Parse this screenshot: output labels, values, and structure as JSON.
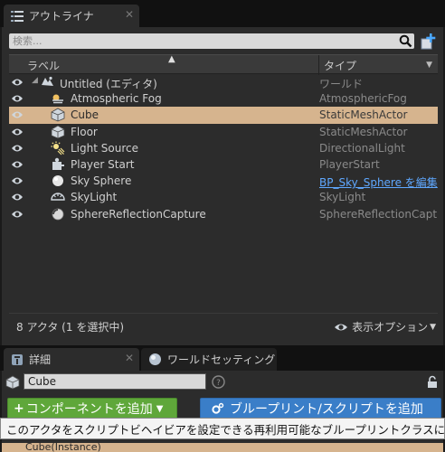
{
  "outliner": {
    "tab_label": "アウトライナ",
    "tab_close": "✕",
    "search_placeholder": "検索...",
    "columns": {
      "label": "ラベル",
      "type": "タイプ"
    },
    "rows": [
      {
        "name": "Untitled (エディタ)",
        "type": "ワールド",
        "icon": "world-icon",
        "indent": 0,
        "selected": false,
        "link": false
      },
      {
        "name": "Atmospheric Fog",
        "type": "AtmosphericFog",
        "icon": "fog-icon",
        "indent": 1,
        "selected": false,
        "link": false
      },
      {
        "name": "Cube",
        "type": "StaticMeshActor",
        "icon": "static-mesh-icon",
        "indent": 1,
        "selected": true,
        "link": false
      },
      {
        "name": "Floor",
        "type": "StaticMeshActor",
        "icon": "static-mesh-icon",
        "indent": 1,
        "selected": false,
        "link": false
      },
      {
        "name": "Light Source",
        "type": "DirectionalLight",
        "icon": "directional-light-icon",
        "indent": 1,
        "selected": false,
        "link": false
      },
      {
        "name": "Player Start",
        "type": "PlayerStart",
        "icon": "player-start-icon",
        "indent": 1,
        "selected": false,
        "link": false
      },
      {
        "name": "Sky Sphere",
        "type": "BP_Sky_Sphere を編集",
        "icon": "sphere-icon",
        "indent": 1,
        "selected": false,
        "link": true
      },
      {
        "name": "SkyLight",
        "type": "SkyLight",
        "icon": "skylight-icon",
        "indent": 1,
        "selected": false,
        "link": false
      },
      {
        "name": "SphereReflectionCapture",
        "type": "SphereReflectionCapture",
        "icon": "reflection-capture-icon",
        "indent": 1,
        "selected": false,
        "link": false
      }
    ],
    "actor_count": "8 アクタ (1 を選択中)",
    "view_options": "表示オプション"
  },
  "details": {
    "tab_label": "詳細",
    "tab_close": "✕",
    "world_settings_tab": "ワールドセッティング",
    "actor_name": "Cube",
    "add_component": "コンポーネントを追加",
    "blueprint_button": "ブループリント/スクリプトを追加",
    "instance_label": "Cube(Instance)",
    "tooltip": "このアクタをスクリプトビヘイビアを設定できる再利用可能なブループリントクラスに変換する"
  },
  "colors": {
    "selection": "#d6b48e",
    "add_button": "#5fa73a",
    "blueprint_button": "#3a7ec8",
    "link": "#5fa8ff"
  }
}
